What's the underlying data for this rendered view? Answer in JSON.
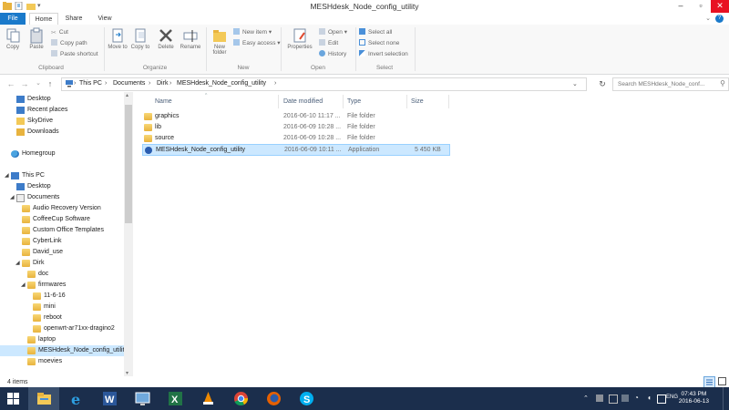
{
  "window": {
    "title": "MESHdesk_Node_config_utility"
  },
  "ribbon_tabs": {
    "file": "File",
    "home": "Home",
    "share": "Share",
    "view": "View"
  },
  "ribbon": {
    "copy": "Copy",
    "paste": "Paste",
    "cut": "Cut",
    "copy_path": "Copy path",
    "paste_shortcut": "Paste shortcut",
    "clipboard": "Clipboard",
    "move_to": "Move to",
    "copy_to": "Copy to",
    "delete": "Delete",
    "rename": "Rename",
    "organize": "Organize",
    "new_folder": "New folder",
    "new_item": "New item",
    "easy_access": "Easy access",
    "new": "New",
    "properties": "Properties",
    "open": "Open",
    "edit": "Edit",
    "history": "History",
    "open_group": "Open",
    "select_all": "Select all",
    "select_none": "Select none",
    "invert_selection": "Invert selection",
    "select": "Select"
  },
  "address": {
    "crumbs": [
      "This PC",
      "Documents",
      "Dirk",
      "MESHdesk_Node_config_utility"
    ],
    "search_placeholder": "Search MESHdesk_Node_conf..."
  },
  "nav": {
    "items": [
      {
        "label": "Desktop",
        "level": 1
      },
      {
        "label": "Recent places",
        "level": 1
      },
      {
        "label": "SkyDrive",
        "level": 1
      },
      {
        "label": "Downloads",
        "level": 1
      },
      {
        "label": "Homegroup",
        "level": 0
      },
      {
        "label": "This PC",
        "level": 0
      },
      {
        "label": "Desktop",
        "level": 1
      },
      {
        "label": "Documents",
        "level": 1
      },
      {
        "label": "Audio Recovery Version",
        "level": 2
      },
      {
        "label": "CoffeeCup Software",
        "level": 2
      },
      {
        "label": "Custom Office Templates",
        "level": 2
      },
      {
        "label": "CyberLink",
        "level": 2
      },
      {
        "label": "David_use",
        "level": 2
      },
      {
        "label": "Dirk",
        "level": 2
      },
      {
        "label": "doc",
        "level": 3
      },
      {
        "label": "firmwares",
        "level": 3
      },
      {
        "label": "11-6-16",
        "level": 4
      },
      {
        "label": "mini",
        "level": 4
      },
      {
        "label": "reboot",
        "level": 4
      },
      {
        "label": "openwrt-ar71xx-dragino2",
        "level": 4
      },
      {
        "label": "laptop",
        "level": 3
      },
      {
        "label": "MESHdesk_Node_config_utility",
        "level": 3
      },
      {
        "label": "moevies",
        "level": 3
      }
    ]
  },
  "columns": {
    "name": "Name",
    "date": "Date modified",
    "type": "Type",
    "size": "Size"
  },
  "files": [
    {
      "name": "graphics",
      "date": "2016-06-10 11:17 ...",
      "type": "File folder",
      "size": ""
    },
    {
      "name": "lib",
      "date": "2016-06-09 10:28 ...",
      "type": "File folder",
      "size": ""
    },
    {
      "name": "source",
      "date": "2016-06-09 10:28 ...",
      "type": "File folder",
      "size": ""
    },
    {
      "name": "MESHdesk_Node_config_utility",
      "date": "2016-06-09 10:11 ...",
      "type": "Application",
      "size": "5 450 KB"
    }
  ],
  "status": {
    "count": "4 items"
  },
  "taskbar": {
    "lang": "ENG",
    "time": "07:43 PM",
    "date": "2016-06-13"
  }
}
